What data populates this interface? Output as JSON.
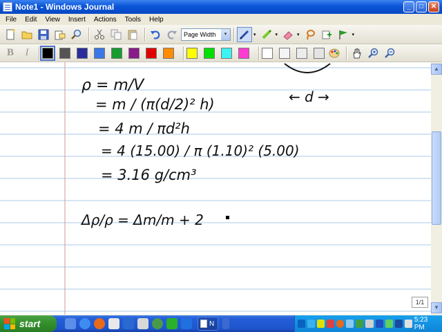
{
  "window": {
    "title": "Note1 - Windows Journal",
    "minimize_glyph": "_",
    "maximize_glyph": "□",
    "close_glyph": "✕"
  },
  "menu": [
    "File",
    "Edit",
    "View",
    "Insert",
    "Actions",
    "Tools",
    "Help"
  ],
  "toolbar": {
    "zoom_value": "Page Width",
    "dropdown_glyph": "▾",
    "bold_glyph": "B",
    "italic_glyph": "I"
  },
  "colors": {
    "pen_swatches": [
      "#000000",
      "#555555",
      "#2b2b9e",
      "#3a78e8",
      "#169b2d",
      "#8a1a8c",
      "#e00000",
      "#ff8c00"
    ],
    "highlighter_swatches": [
      "#ffff00",
      "#00e000",
      "#3df2f2",
      "#ff3cd2"
    ],
    "blank_swatches": [
      "#ffffff",
      "#f4f4f4",
      "#ececec",
      "#e4e4e4"
    ],
    "page_line": "#a8c8e8",
    "margin_line": "#cc9999"
  },
  "page": {
    "indicator": "1/1"
  },
  "scrollbar": {
    "up_glyph": "▲",
    "down_glyph": "▼"
  },
  "handwriting": {
    "line1": "ρ = m/V",
    "line2": "= m / (π(d/2)² h)",
    "line3": "= 4 m / πd²h",
    "line4": "= 4 (15.00) / π (1.10)² (5.00)",
    "line5": "= 3.16 g/cm³",
    "diameter_arrow": "← d →",
    "uncertainty": "Δρ/ρ = Δm/m + 2"
  },
  "taskbar": {
    "start_label": "start",
    "task_label": "N",
    "clock": "5:23 PM"
  }
}
